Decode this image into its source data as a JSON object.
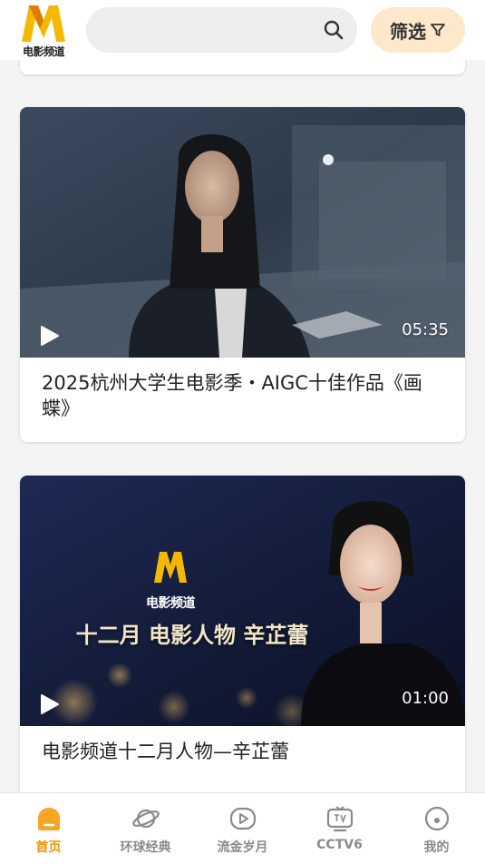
{
  "header": {
    "logo_text": "电影频道",
    "search_placeholder": "",
    "filter_label": "筛选"
  },
  "videos": [
    {
      "duration": "05:35",
      "title": "2025杭州大学生电影季・AIGC十佳作品《画蝶》"
    },
    {
      "duration": "01:00",
      "title": "电影频道十二月人物—辛芷蕾",
      "thumb_logo_text": "电影频道",
      "thumb_caption": "十二月 电影人物 辛芷蕾"
    }
  ],
  "tabbar": {
    "items": [
      {
        "label": "首页",
        "icon": "home-icon",
        "active": true
      },
      {
        "label": "环球经典",
        "icon": "planet-icon",
        "active": false
      },
      {
        "label": "流金岁月",
        "icon": "play-circle-icon",
        "active": false
      },
      {
        "label": "CCTV6",
        "icon": "tv-icon",
        "active": false
      },
      {
        "label": "我的",
        "icon": "profile-icon",
        "active": false
      }
    ]
  },
  "colors": {
    "accent": "#f29400",
    "filter_bg": "#fde8cc",
    "inactive": "#8a8a8a"
  }
}
